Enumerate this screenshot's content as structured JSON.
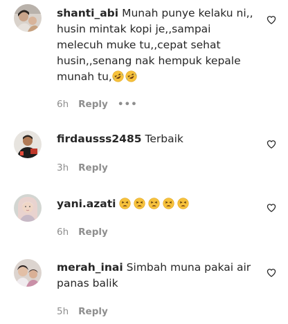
{
  "comments": [
    {
      "username": "shanti_abi",
      "text": "Munah punye kelaku ni,, husin mintak kopi je,,sampai melecuh muke tu,,cepat sehat husin,,senang nak hempuk kepale munah tu,",
      "emojis": [
        "rofl-emoji",
        "rofl-emoji"
      ],
      "time": "6h",
      "reply_label": "Reply",
      "more_label": "•••"
    },
    {
      "username": "firdausss2485",
      "text": "Terbaik",
      "emojis": [],
      "time": "3h",
      "reply_label": "Reply"
    },
    {
      "username": "yani.azati",
      "text": "",
      "emojis": [
        "tired-face-emoji",
        "tired-face-emoji",
        "tired-face-emoji",
        "tired-face-emoji",
        "tired-face-emoji"
      ],
      "time": "6h",
      "reply_label": "Reply"
    },
    {
      "username": "merah_inai",
      "text": "Simbah muna pakai air panas balik",
      "emojis": [],
      "time": "5h",
      "reply_label": "Reply"
    }
  ],
  "icons": {
    "like": "heart-outline-icon",
    "more": "more-dots-icon"
  },
  "colors": {
    "text": "#262626",
    "secondary": "#8e8e8e",
    "background": "#ffffff",
    "emoji_face": "#f7c23c",
    "emoji_tear": "#4aa3e8"
  }
}
